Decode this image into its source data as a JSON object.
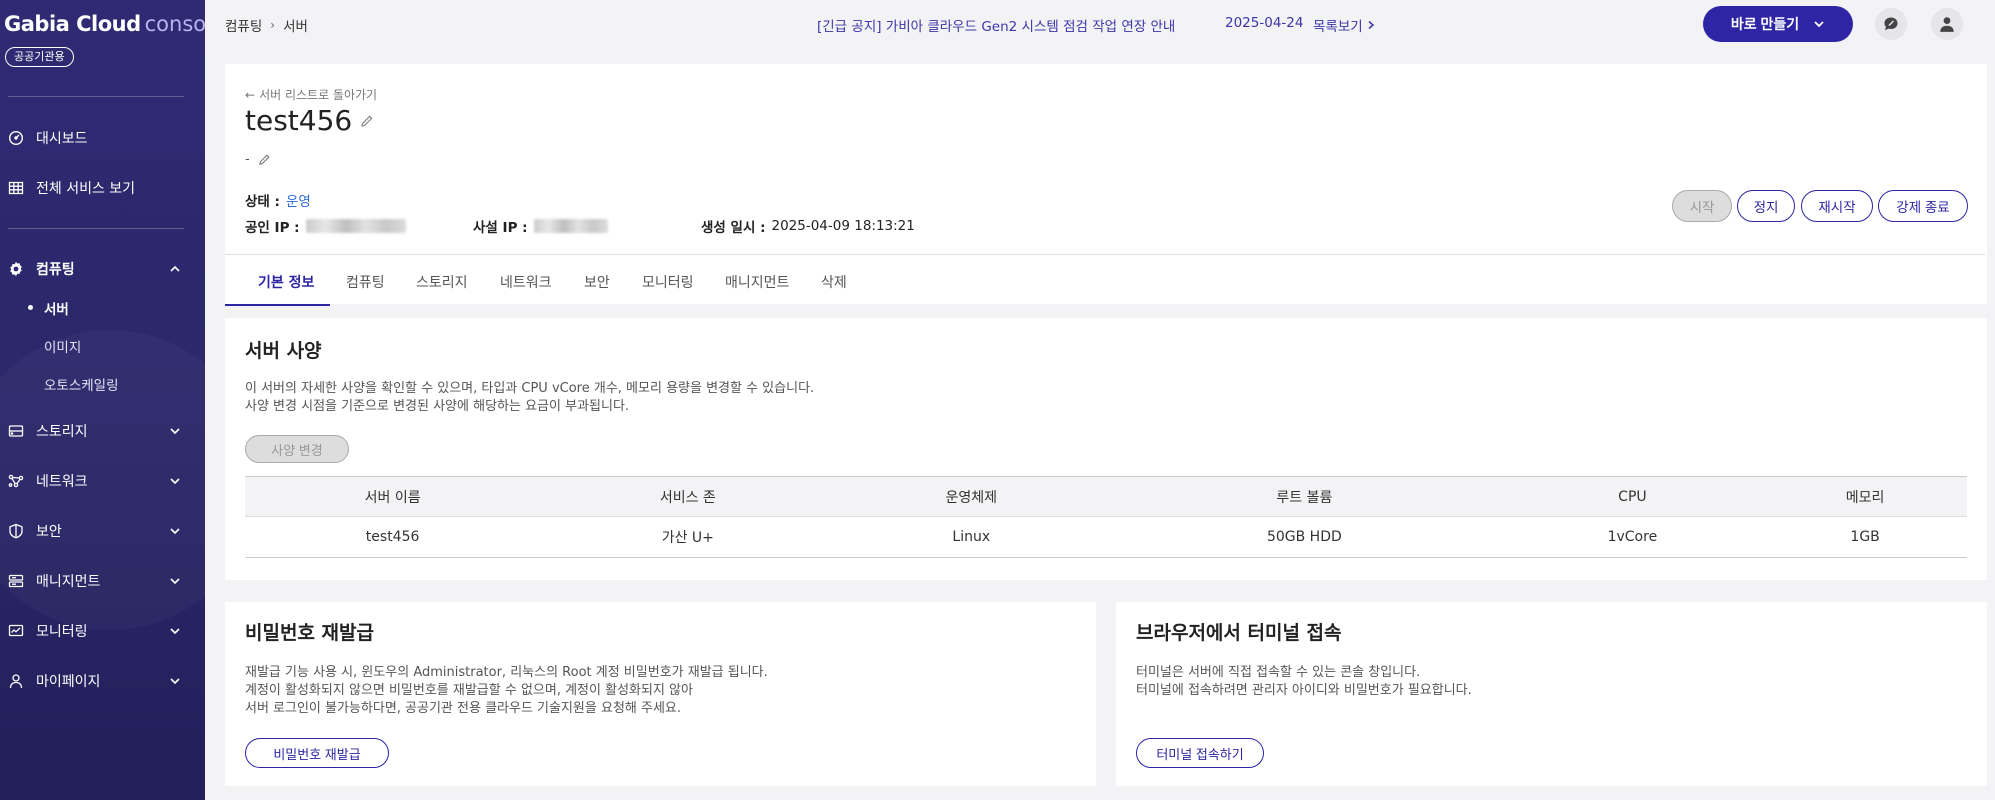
{
  "sidebar": {
    "logo_brand": "Gabia Cloud",
    "logo_console": "console",
    "badge": "공공기관용",
    "items": [
      {
        "label": "대시보드"
      },
      {
        "label": "전체 서비스 보기"
      },
      {
        "label": "컴퓨팅"
      },
      {
        "label": "스토리지"
      },
      {
        "label": "네트워크"
      },
      {
        "label": "보안"
      },
      {
        "label": "매니지먼트"
      },
      {
        "label": "모니터링"
      },
      {
        "label": "마이페이지"
      }
    ],
    "computing_sub": [
      {
        "label": "서버"
      },
      {
        "label": "이미지"
      },
      {
        "label": "오토스케일링"
      }
    ]
  },
  "topbar": {
    "breadcrumb": [
      "컴퓨팅",
      "서버"
    ],
    "notice": "[긴급 공지] 가비아 클라우드 Gen2 시스템 점검 작업 연장 안내",
    "notice_date": "2025-04-24",
    "notice_list": "목록보기",
    "make_button": "바로 만들기"
  },
  "server": {
    "back_link": "서버 리스트로 돌아가기",
    "name": "test456",
    "description": "-",
    "status_label": "상태 :",
    "status_value": "운영",
    "public_ip_label": "공인 IP :",
    "private_ip_label": "사설 IP :",
    "created_label": "생성 일시 :",
    "created_value": "2025-04-09 18:13:21",
    "actions": {
      "start": "시작",
      "stop": "정지",
      "restart": "재시작",
      "force_stop": "강제 종료"
    },
    "tabs": [
      "기본 정보",
      "컴퓨팅",
      "스토리지",
      "네트워크",
      "보안",
      "모니터링",
      "매니지먼트",
      "삭제"
    ]
  },
  "spec": {
    "title": "서버 사양",
    "line1": "이 서버의 자세한 사양을 확인할 수 있으며, 타입과 CPU vCore 개수, 메모리 용량을 변경할 수 있습니다.",
    "line2": "사양 변경 시점을 기준으로 변경된 사양에 해당하는 요금이 부과됩니다.",
    "change_button": "사양 변경",
    "columns": [
      "서버 이름",
      "서비스 존",
      "운영체제",
      "루트 볼륨",
      "CPU",
      "메모리"
    ],
    "row": [
      "test456",
      "가산 U+",
      "Linux",
      "50GB HDD",
      "1vCore",
      "1GB"
    ]
  },
  "password": {
    "title": "비밀번호 재발급",
    "line1": "재발급 기능 사용 시, 윈도우의 Administrator, 리눅스의 Root 계정 비밀번호가 재발급 됩니다.",
    "line2": "계정이 활성화되지 않으면 비밀번호를 재발급할 수 없으며, 계정이 활성화되지 않아",
    "line3": "서버 로그인이 불가능하다면, 공공기관 전용 클라우드 기술지원을 요청해 주세요.",
    "button": "비밀번호 재발급"
  },
  "terminal": {
    "title": "브라우저에서 터미널 접속",
    "line1": "터미널은 서버에 직접 접속할 수 있는 콘솔 창입니다.",
    "line2": "터미널에 접속하려면 관리자 아이디와 비밀번호가 필요합니다.",
    "button": "터미널 접속하기"
  }
}
